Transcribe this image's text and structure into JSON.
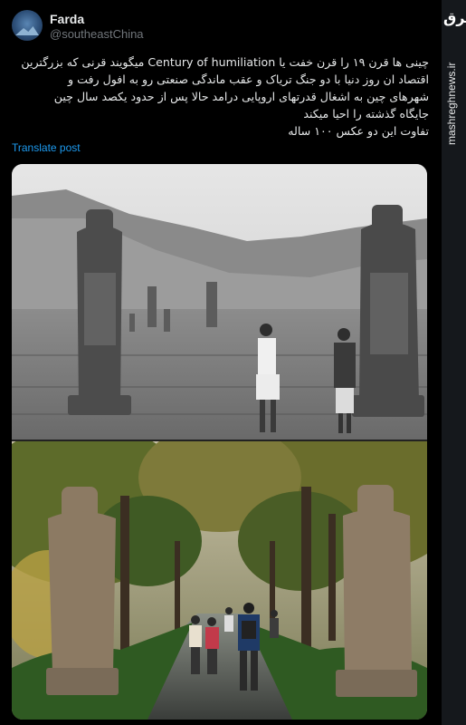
{
  "user": {
    "display_name": "Farda",
    "handle": "@southeastChina"
  },
  "tweet": {
    "lines": [
      "چینی ها قرن ۱۹ را قرن خفت یا Century of humiliation میگویند قرنی که بزرگترین",
      "اقتصاد ان روز دنیا با دو جنگ تریاک  و عقب ماندگی صنعتی رو به افول رفت و",
      "شهرهای چین به اشغال قدرتهای اروپایی درامد حالا پس از حدود یکصد سال چین",
      "جایگاه گذشته را احیا میکند",
      "تفاوت این دو عکس ۱۰۰ ساله"
    ],
    "translate_label": "Translate post"
  },
  "watermark": {
    "logo": "مشرق",
    "url": "mashreghnews.ir"
  },
  "media": {
    "top_photo": "black-and-white photo of stone warrior statues on an open plain with two men standing between them",
    "bottom_photo": "color photo of the same stone warrior statues along a tree-lined path with visitors walking"
  },
  "colors": {
    "background": "#000000",
    "text": "#e7e9ea",
    "muted": "#71767b",
    "link": "#1d9bf0"
  }
}
